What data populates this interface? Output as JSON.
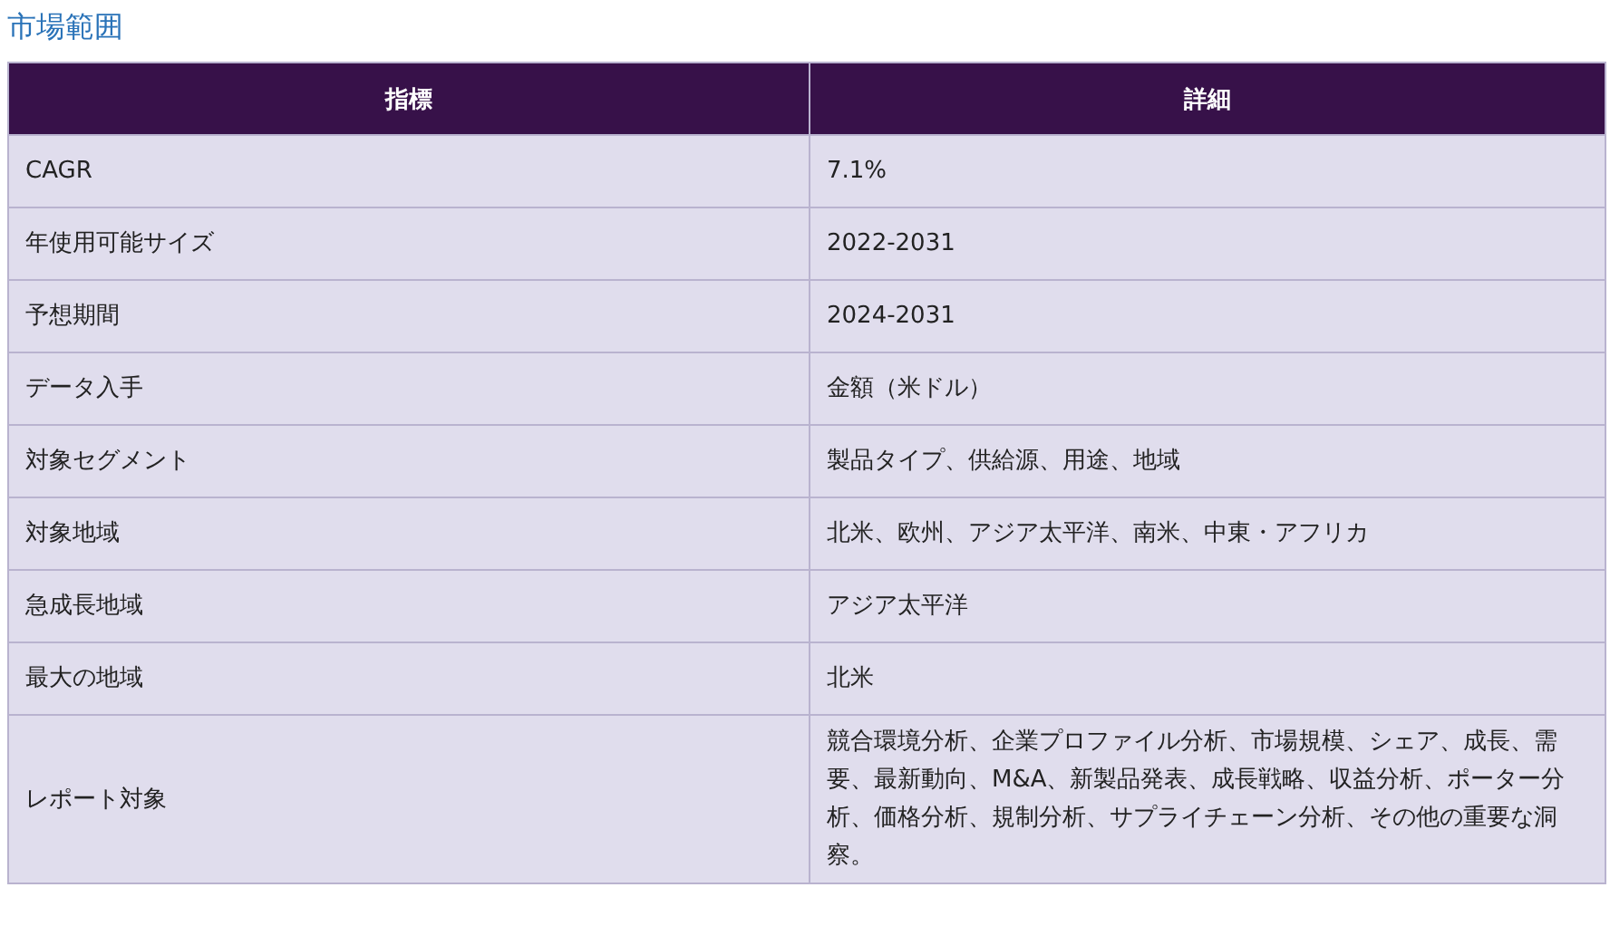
{
  "title": "市場範囲",
  "table": {
    "columns": [
      "指標",
      "詳細"
    ],
    "rows": [
      [
        "CAGR",
        "7.1%"
      ],
      [
        "年使用可能サイズ",
        "2022-2031"
      ],
      [
        "予想期間",
        "2024-2031"
      ],
      [
        "データ入手",
        "金額（米ドル）"
      ],
      [
        "対象セグメント",
        "製品タイプ、供給源、用途、地域"
      ],
      [
        "対象地域",
        "北米、欧州、アジア太平洋、南米、中東・アフリカ"
      ],
      [
        "急成長地域",
        "アジア太平洋"
      ],
      [
        "最大の地域",
        "北米"
      ],
      [
        "レポート対象",
        "競合環境分析、企業プロファイル分析、市場規模、シェア、成長、需要、最新動向、M&A、新製品発表、成長戦略、収益分析、ポーター分析、価格分析、規制分析、サプライチェーン分析、その他の重要な洞察。"
      ]
    ]
  }
}
